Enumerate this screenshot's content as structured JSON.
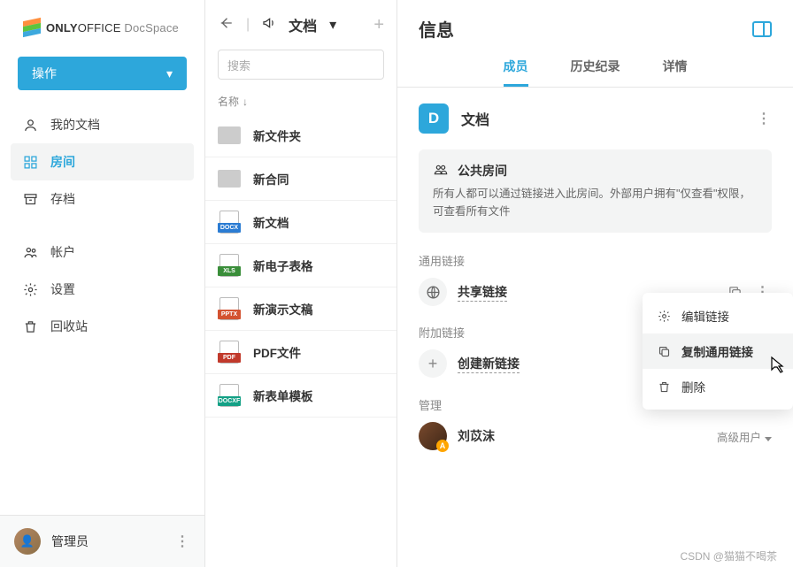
{
  "brand": {
    "name_bold": "ONLY",
    "name_mid": "OFFICE ",
    "product": "DocSpace"
  },
  "sidebar": {
    "action_label": "操作",
    "items": [
      {
        "label": "我的文档",
        "icon": "person-doc"
      },
      {
        "label": "房间",
        "icon": "grid",
        "active": true
      },
      {
        "label": "存档",
        "icon": "archive"
      }
    ],
    "lower": [
      {
        "label": "帐户",
        "icon": "users"
      },
      {
        "label": "设置",
        "icon": "gear"
      },
      {
        "label": "回收站",
        "icon": "trash"
      }
    ],
    "admin_label": "管理员"
  },
  "files": {
    "crumb": "文档",
    "search_placeholder": "搜索",
    "sort_label": "名称",
    "items": [
      {
        "name": "新文件夹",
        "type": "folder"
      },
      {
        "name": "新合同",
        "type": "folder"
      },
      {
        "name": "新文档",
        "type": "docx"
      },
      {
        "name": "新电子表格",
        "type": "xls"
      },
      {
        "name": "新演示文稿",
        "type": "pptx"
      },
      {
        "name": "PDF文件",
        "type": "pdf"
      },
      {
        "name": "新表单模板",
        "type": "docxf"
      }
    ]
  },
  "info": {
    "title": "信息",
    "tabs": [
      {
        "label": "成员",
        "active": true
      },
      {
        "label": "历史纪录"
      },
      {
        "label": "详情"
      }
    ],
    "room": {
      "badge": "D",
      "name": "文档"
    },
    "notice": {
      "title": "公共房间",
      "text": "所有人都可以通过链接进入此房间。外部用户拥有\"仅查看\"权限，可查看所有文件"
    },
    "general_link_section": "通用链接",
    "share_link": "共享链接",
    "additional_link_section": "附加链接",
    "create_link": "创建新链接",
    "admin_section": "管理",
    "member": {
      "name": "刘苡沫",
      "role": "高级用户"
    },
    "menu": {
      "edit": "编辑链接",
      "copy": "复制通用链接",
      "delete": "删除"
    }
  },
  "watermark": "CSDN @猫猫不喝茶"
}
